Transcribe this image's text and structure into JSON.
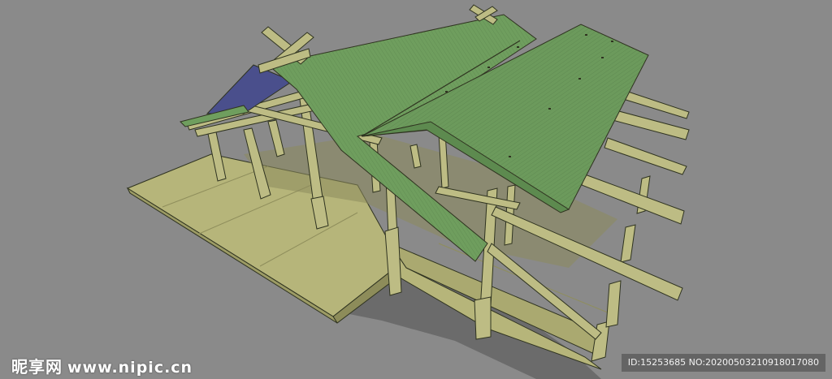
{
  "watermark": {
    "site_cn": "昵享网",
    "site_url": "www.nipic.cn",
    "id_text": "ID:15253685 NO:20200503210918017080"
  },
  "colors": {
    "background": "#8a8a8a",
    "floor": "#b6b57a",
    "timber": "#bdbc84",
    "roof": "#6f9e5e",
    "roof_underside": "#4a4f8c",
    "outline": "#2f3320"
  }
}
